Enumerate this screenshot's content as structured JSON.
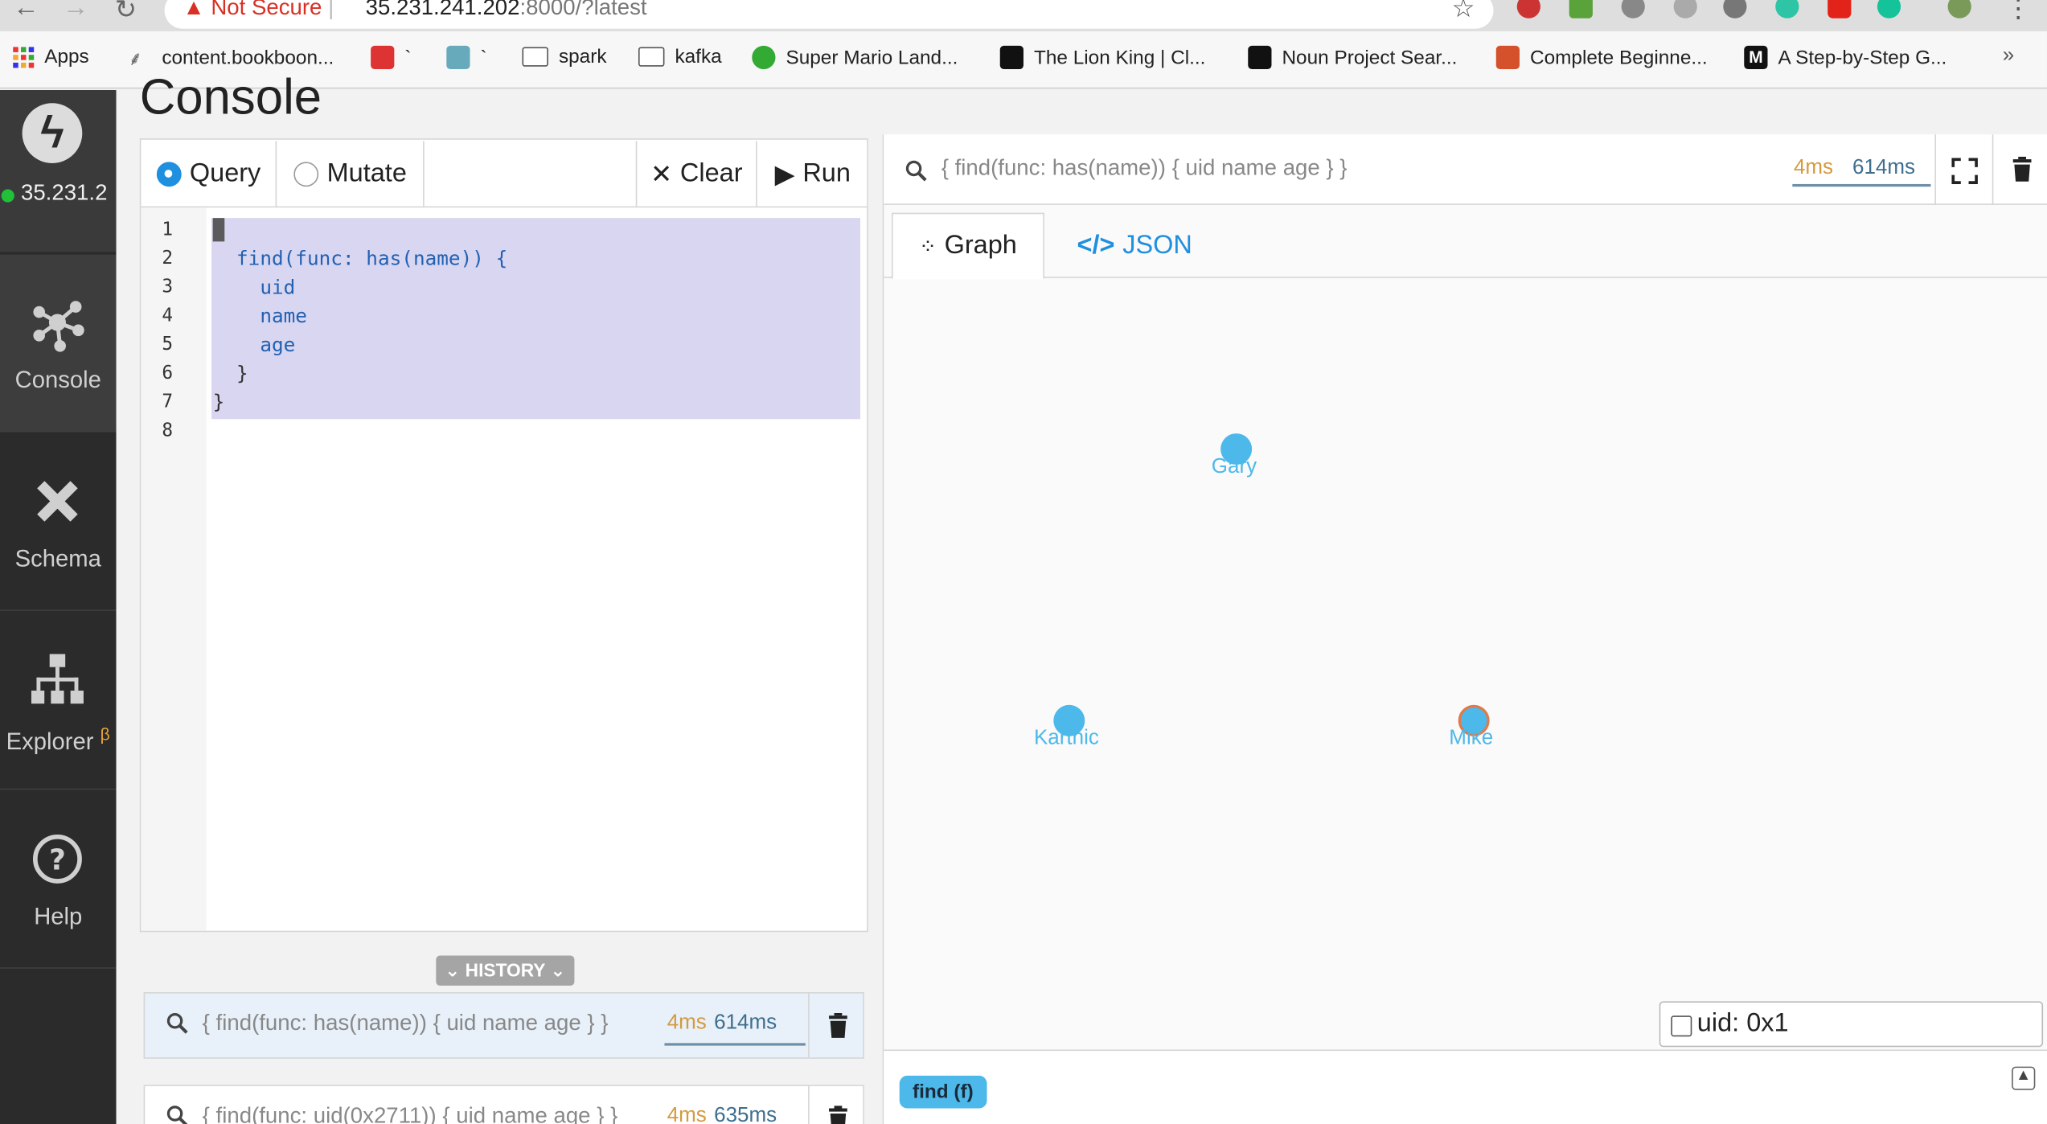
{
  "browser": {
    "not_secure": "Not Secure",
    "url_host": "35.231.241.202",
    "url_rest": ":8000/?latest",
    "bookmarks": [
      {
        "label": "Apps"
      },
      {
        "label": "content.bookboon..."
      },
      {
        "label": "`"
      },
      {
        "label": "`"
      },
      {
        "label": "spark"
      },
      {
        "label": "kafka"
      },
      {
        "label": "Super Mario Land..."
      },
      {
        "label": "The Lion King | Cl..."
      },
      {
        "label": "Noun Project Sear..."
      },
      {
        "label": "Complete Beginne..."
      },
      {
        "label": "A Step-by-Step G..."
      }
    ],
    "more": "»"
  },
  "sidebar": {
    "server": "35.231.2",
    "items": [
      {
        "label": "Console",
        "icon": "console-icon"
      },
      {
        "label": "Schema",
        "icon": "schema-icon"
      },
      {
        "label": "Explorer",
        "beta": "β",
        "icon": "explorer-icon"
      },
      {
        "label": "Help",
        "icon": "help-icon"
      }
    ]
  },
  "main": {
    "title": "Console"
  },
  "editor": {
    "query_label": "Query",
    "mutate_label": "Mutate",
    "clear_label": "Clear",
    "run_label": "Run",
    "line_numbers": [
      "1",
      "2",
      "3",
      "4",
      "5",
      "6",
      "7",
      "8"
    ],
    "lines": [
      "{",
      "  find(func: has(name)) {",
      "    uid",
      "    name",
      "    age",
      "  }",
      "}",
      ""
    ]
  },
  "history": {
    "label": "HISTORY",
    "items": [
      {
        "query": "{ find(func: has(name)) { uid name age } }",
        "server_time": "4ms",
        "total_time": "614ms"
      },
      {
        "query": "{ find(func: uid(0x2711)) { uid name age } }",
        "server_time": "4ms",
        "total_time": "635ms"
      }
    ]
  },
  "result": {
    "query": "{ find(func: has(name)) { uid name age } }",
    "server_time": "4ms",
    "total_time": "614ms",
    "tabs": [
      {
        "label": "Graph"
      },
      {
        "label": "JSON"
      }
    ],
    "nodes": [
      {
        "label": "Gary"
      },
      {
        "label": "Karthic"
      },
      {
        "label": "Mike"
      }
    ],
    "hover_info": "uid: 0x1",
    "predicate_badge": "find (f)",
    "colors": {
      "node": "#4db8ea",
      "accent": "#1f8fe0",
      "server_time": "#d49a3e",
      "total_time": "#3e6e8e"
    }
  }
}
